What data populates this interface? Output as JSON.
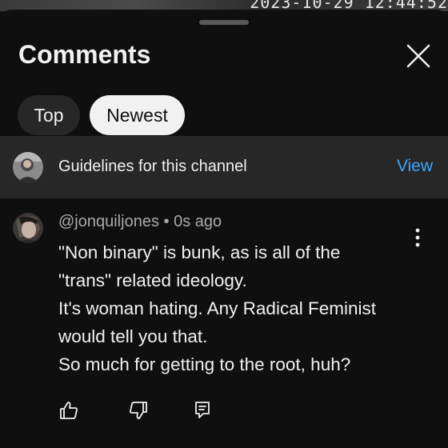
{
  "video": {
    "timestamp": "2023-10-29 12:44:52"
  },
  "sheet": {
    "title": "Comments",
    "close_icon": "close-icon",
    "chips": [
      {
        "label": "Top",
        "selected": false
      },
      {
        "label": "Newest",
        "selected": true
      }
    ]
  },
  "guidelines": {
    "text": "Guidelines for this channel",
    "action_label": "View",
    "action_color": "#3ea6ff"
  },
  "comment": {
    "author": "@jonquiljones",
    "separator": "•",
    "time": "0s ago",
    "lines": [
      "\"Non binary\" is bunk, as is all of the",
      "\"trans\" related ideology.",
      "It's woman hating. Any Radical Feminist",
      "would tell you that.",
      "So much for getting to the root, huh?"
    ],
    "actions": [
      "thumbs-up-icon",
      "thumbs-down-icon",
      "reply-icon"
    ],
    "menu_icon": "more-vert-icon"
  },
  "colors": {
    "background": "#0f0f0f",
    "banner": "#272727",
    "text": "#f1f1f1",
    "meta": "#aaaaaa",
    "link": "#3ea6ff"
  }
}
